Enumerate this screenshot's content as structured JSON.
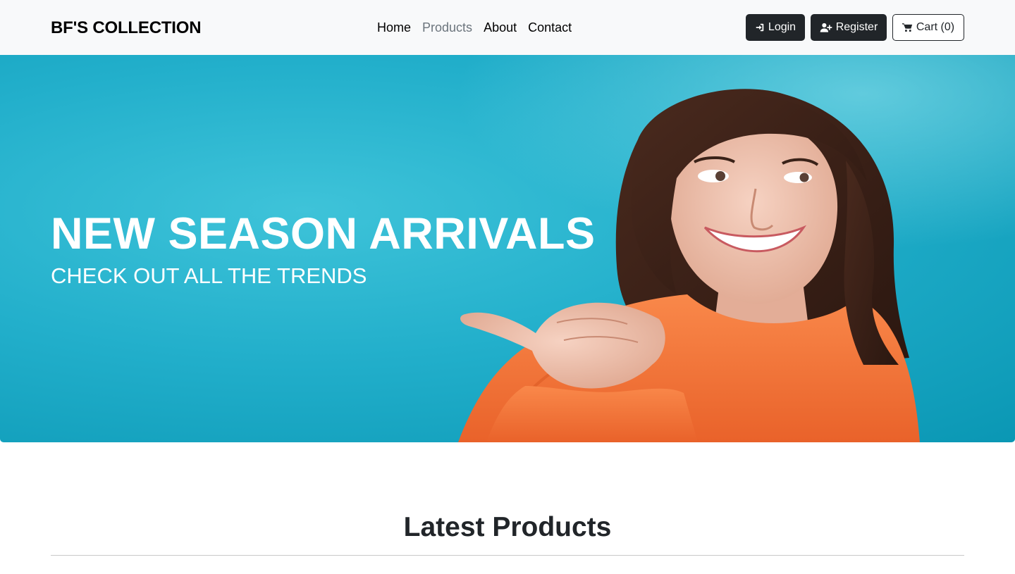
{
  "brand": "BF'S COLLECTION",
  "nav": {
    "links": [
      "Home",
      "Products",
      "About",
      "Contact"
    ],
    "active": "Products"
  },
  "buttons": {
    "login": "Login",
    "register": "Register",
    "cart": "Cart (0)"
  },
  "icons": {
    "login": "sign-in-icon",
    "register": "user-plus-icon",
    "cart": "shopping-cart-icon"
  },
  "hero": {
    "title": "NEW SEASON ARRIVALS",
    "subtitle": "CHECK OUT ALL THE TRENDS"
  },
  "section": {
    "title": "Latest Products"
  },
  "colors": {
    "navbar_bg": "#f8f9fa",
    "button_dark": "#212529",
    "hero_bg": "#22afcb",
    "sweater": "#f5773a"
  }
}
